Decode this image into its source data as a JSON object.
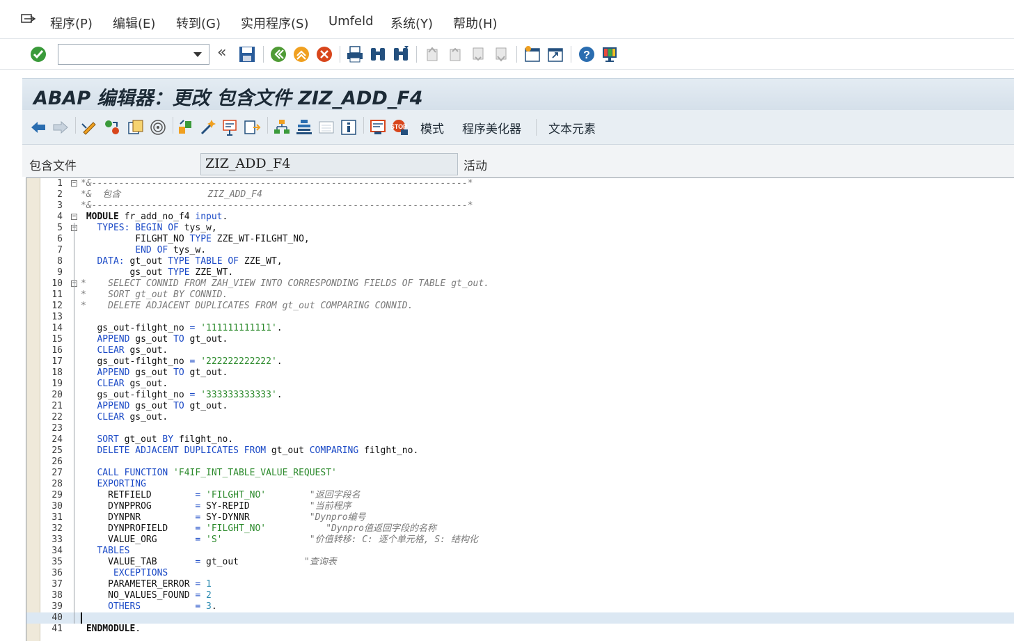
{
  "menu": {
    "items": [
      "程序(P)",
      "编辑(E)",
      "转到(G)",
      "实用程序(S)",
      "Umfeld",
      "系统(Y)",
      "帮助(H)"
    ]
  },
  "system_toolbar": {
    "command_field": {
      "value": "",
      "placeholder": ""
    }
  },
  "title": {
    "text": "ABAP 编辑器：更改 包含文件 ZIZ_ADD_F4"
  },
  "app_toolbar": {
    "buttons": [
      "模式",
      "程序美化器",
      "文本元素"
    ]
  },
  "include": {
    "label": "包含文件",
    "value": "ZIZ_ADD_F4",
    "status": "活动"
  },
  "editor": {
    "current_line": 40,
    "lines": [
      {
        "n": "1",
        "fold": "⊟",
        "t": [
          [
            "cm",
            "*&---------------------------------------------------------------------*"
          ]
        ]
      },
      {
        "n": "2",
        "fold": "",
        "t": [
          [
            "cm",
            "*&  包含                ZIZ_ADD_F4"
          ]
        ]
      },
      {
        "n": "3",
        "fold": "",
        "t": [
          [
            "cm",
            "*&---------------------------------------------------------------------*"
          ]
        ]
      },
      {
        "n": "4",
        "fold": "⊟",
        "t": [
          [
            "bold",
            " MODULE"
          ],
          [
            "tx",
            " fr_add_no_f4 "
          ],
          [
            "kw",
            "input"
          ],
          [
            "tx",
            "."
          ]
        ]
      },
      {
        "n": "5",
        "fold": "⊟",
        "t": [
          [
            "kw",
            "   TYPES: BEGIN OF"
          ],
          [
            "tx",
            " tys_w,"
          ]
        ]
      },
      {
        "n": "6",
        "fold": "",
        "t": [
          [
            "tx",
            "          FILGHT_NO "
          ],
          [
            "kw",
            "TYPE"
          ],
          [
            "tx",
            " ZZE_WT-FILGHT_NO,"
          ]
        ]
      },
      {
        "n": "7",
        "fold": "",
        "t": [
          [
            "kw",
            "          END OF"
          ],
          [
            "tx",
            " tys_w."
          ]
        ]
      },
      {
        "n": "8",
        "fold": "",
        "t": [
          [
            "kw",
            "   DATA:"
          ],
          [
            "tx",
            " gt_out "
          ],
          [
            "kw",
            "TYPE TABLE OF"
          ],
          [
            "tx",
            " ZZE_WT,"
          ]
        ]
      },
      {
        "n": "9",
        "fold": "",
        "t": [
          [
            "tx",
            "         gs_out "
          ],
          [
            "kw",
            "TYPE"
          ],
          [
            "tx",
            " ZZE_WT."
          ]
        ]
      },
      {
        "n": "10",
        "fold": "⊟",
        "t": [
          [
            "cm",
            "*    SELECT CONNID FROM ZAH_VIEW INTO CORRESPONDING FIELDS OF TABLE gt_out."
          ]
        ]
      },
      {
        "n": "11",
        "fold": "",
        "t": [
          [
            "cm",
            "*    SORT gt_out BY CONNID."
          ]
        ]
      },
      {
        "n": "12",
        "fold": "",
        "t": [
          [
            "cm",
            "*    DELETE ADJACENT DUPLICATES FROM gt_out COMPARING CONNID."
          ]
        ]
      },
      {
        "n": "13",
        "fold": "",
        "t": []
      },
      {
        "n": "14",
        "fold": "",
        "t": [
          [
            "tx",
            "   gs_out-filght_no "
          ],
          [
            "kw",
            "="
          ],
          [
            "st",
            " '111111111111'"
          ],
          [
            "tx",
            "."
          ]
        ]
      },
      {
        "n": "15",
        "fold": "",
        "t": [
          [
            "kw",
            "   APPEND"
          ],
          [
            "tx",
            " gs_out "
          ],
          [
            "kw",
            "TO"
          ],
          [
            "tx",
            " gt_out."
          ]
        ]
      },
      {
        "n": "16",
        "fold": "",
        "t": [
          [
            "kw",
            "   CLEAR"
          ],
          [
            "tx",
            " gs_out."
          ]
        ]
      },
      {
        "n": "17",
        "fold": "",
        "t": [
          [
            "tx",
            "   gs_out-filght_no "
          ],
          [
            "kw",
            "="
          ],
          [
            "st",
            " '222222222222'"
          ],
          [
            "tx",
            "."
          ]
        ]
      },
      {
        "n": "18",
        "fold": "",
        "t": [
          [
            "kw",
            "   APPEND"
          ],
          [
            "tx",
            " gs_out "
          ],
          [
            "kw",
            "TO"
          ],
          [
            "tx",
            " gt_out."
          ]
        ]
      },
      {
        "n": "19",
        "fold": "",
        "t": [
          [
            "kw",
            "   CLEAR"
          ],
          [
            "tx",
            " gs_out."
          ]
        ]
      },
      {
        "n": "20",
        "fold": "",
        "t": [
          [
            "tx",
            "   gs_out-filght_no "
          ],
          [
            "kw",
            "="
          ],
          [
            "st",
            " '333333333333'"
          ],
          [
            "tx",
            "."
          ]
        ]
      },
      {
        "n": "21",
        "fold": "",
        "t": [
          [
            "kw",
            "   APPEND"
          ],
          [
            "tx",
            " gs_out "
          ],
          [
            "kw",
            "TO"
          ],
          [
            "tx",
            " gt_out."
          ]
        ]
      },
      {
        "n": "22",
        "fold": "",
        "t": [
          [
            "kw",
            "   CLEAR"
          ],
          [
            "tx",
            " gs_out."
          ]
        ]
      },
      {
        "n": "23",
        "fold": "",
        "t": []
      },
      {
        "n": "24",
        "fold": "",
        "t": [
          [
            "kw",
            "   SORT"
          ],
          [
            "tx",
            " gt_out "
          ],
          [
            "kw",
            "BY"
          ],
          [
            "tx",
            " filght_no."
          ]
        ]
      },
      {
        "n": "25",
        "fold": "",
        "t": [
          [
            "kw",
            "   DELETE ADJACENT DUPLICATES FROM"
          ],
          [
            "tx",
            " gt_out "
          ],
          [
            "kw",
            "COMPARING"
          ],
          [
            "tx",
            " filght_no."
          ]
        ]
      },
      {
        "n": "26",
        "fold": "",
        "t": []
      },
      {
        "n": "27",
        "fold": "",
        "t": [
          [
            "kw",
            "   CALL FUNCTION"
          ],
          [
            "st",
            " 'F4IF_INT_TABLE_VALUE_REQUEST'"
          ]
        ]
      },
      {
        "n": "28",
        "fold": "",
        "t": [
          [
            "kw",
            "   EXPORTING"
          ]
        ]
      },
      {
        "n": "29",
        "fold": "",
        "t": [
          [
            "tx",
            "     RETFIELD        "
          ],
          [
            "kw",
            "="
          ],
          [
            "st",
            " 'FILGHT_NO'"
          ],
          [
            "cm",
            "        \"返回字段名"
          ]
        ]
      },
      {
        "n": "30",
        "fold": "",
        "t": [
          [
            "tx",
            "     DYNPPROG        "
          ],
          [
            "kw",
            "="
          ],
          [
            "tx",
            " SY-REPID"
          ],
          [
            "cm",
            "           \"当前程序"
          ]
        ]
      },
      {
        "n": "31",
        "fold": "",
        "t": [
          [
            "tx",
            "     DYNPNR          "
          ],
          [
            "kw",
            "="
          ],
          [
            "tx",
            " SY-DYNNR"
          ],
          [
            "cm",
            "           \"Dynpro编号"
          ]
        ]
      },
      {
        "n": "32",
        "fold": "",
        "t": [
          [
            "tx",
            "     DYNPROFIELD     "
          ],
          [
            "kw",
            "="
          ],
          [
            "st",
            " 'FILGHT_NO'"
          ],
          [
            "cm",
            "           \"Dynpro值返回字段的名称"
          ]
        ]
      },
      {
        "n": "33",
        "fold": "",
        "t": [
          [
            "tx",
            "     VALUE_ORG       "
          ],
          [
            "kw",
            "="
          ],
          [
            "st",
            " 'S'"
          ],
          [
            "cm",
            "                \"价值转移: C: 逐个单元格, S: 结构化"
          ]
        ]
      },
      {
        "n": "34",
        "fold": "",
        "t": [
          [
            "kw",
            "   TABLES"
          ]
        ]
      },
      {
        "n": "35",
        "fold": "",
        "t": [
          [
            "tx",
            "     VALUE_TAB       "
          ],
          [
            "kw",
            "="
          ],
          [
            "tx",
            " gt_out"
          ],
          [
            "cm",
            "            \"查询表"
          ]
        ]
      },
      {
        "n": "36",
        "fold": "",
        "t": [
          [
            "kw",
            "      EXCEPTIONS"
          ]
        ]
      },
      {
        "n": "37",
        "fold": "",
        "t": [
          [
            "tx",
            "     PARAMETER_ERROR "
          ],
          [
            "kw",
            "="
          ],
          [
            "nm",
            " 1"
          ]
        ]
      },
      {
        "n": "38",
        "fold": "",
        "t": [
          [
            "tx",
            "     NO_VALUES_FOUND "
          ],
          [
            "kw",
            "="
          ],
          [
            "nm",
            " 2"
          ]
        ]
      },
      {
        "n": "39",
        "fold": "",
        "t": [
          [
            "kw",
            "     OTHERS          ="
          ],
          [
            "nm",
            " 3"
          ],
          [
            "tx",
            "."
          ]
        ]
      },
      {
        "n": "40",
        "fold": "",
        "t": []
      },
      {
        "n": "41",
        "fold": "",
        "t": [
          [
            "bold",
            " ENDMODULE"
          ],
          [
            "tx",
            "."
          ]
        ]
      }
    ]
  }
}
